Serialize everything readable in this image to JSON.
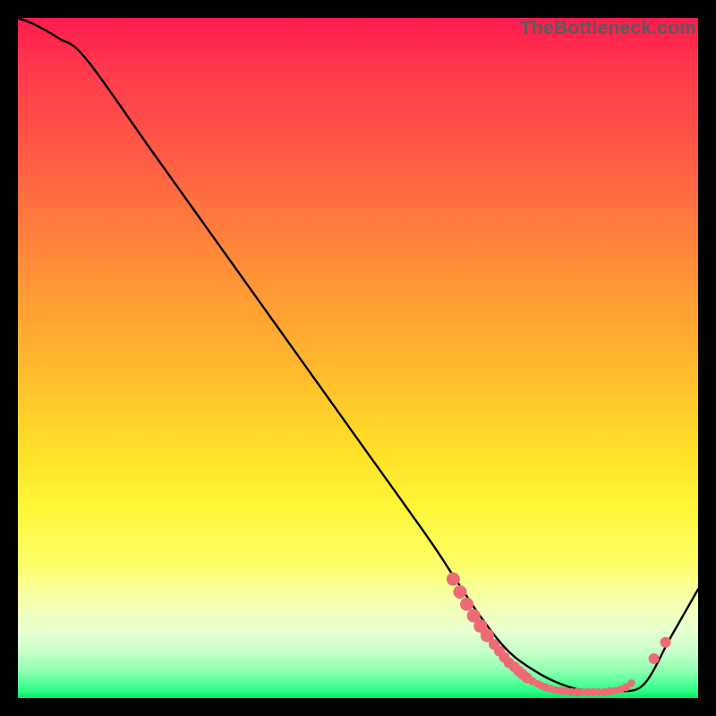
{
  "watermark": "TheBottleneck.com",
  "colors": {
    "curve": "#000000",
    "marker_fill": "#ed6b74",
    "marker_stroke": "#ed6b74",
    "background_black": "#000000"
  },
  "chart_data": {
    "type": "line",
    "title": "",
    "xlabel": "",
    "ylabel": "",
    "xlim": [
      0,
      100
    ],
    "ylim": [
      0,
      100
    ],
    "legend": false,
    "grid": false,
    "series": [
      {
        "name": "bottleneck-curve",
        "x": [
          0,
          2.5,
          6,
          10,
          20,
          30,
          40,
          50,
          60,
          64,
          68,
          72,
          76,
          80,
          84,
          88,
          92,
          96,
          100
        ],
        "y": [
          100,
          99,
          97,
          94,
          80,
          66,
          52,
          38,
          24,
          18,
          12,
          7,
          4,
          2,
          1,
          1,
          2,
          9,
          16
        ]
      }
    ],
    "markers": [
      {
        "x": 64.0,
        "y": 17.5
      },
      {
        "x": 65.0,
        "y": 15.6
      },
      {
        "x": 66.0,
        "y": 13.8
      },
      {
        "x": 67.0,
        "y": 12.1
      },
      {
        "x": 68.0,
        "y": 10.6
      },
      {
        "x": 69.0,
        "y": 9.2
      },
      {
        "x": 70.0,
        "y": 7.9
      },
      {
        "x": 70.8,
        "y": 6.9
      },
      {
        "x": 71.5,
        "y": 6.0
      },
      {
        "x": 72.2,
        "y": 5.2
      },
      {
        "x": 73.0,
        "y": 4.6
      },
      {
        "x": 73.6,
        "y": 4.0
      },
      {
        "x": 74.2,
        "y": 3.5
      },
      {
        "x": 74.8,
        "y": 3.0
      },
      {
        "x": 75.6,
        "y": 2.5
      },
      {
        "x": 76.4,
        "y": 2.1
      },
      {
        "x": 77.0,
        "y": 1.8
      },
      {
        "x": 77.6,
        "y": 1.6
      },
      {
        "x": 78.3,
        "y": 1.4
      },
      {
        "x": 79.0,
        "y": 1.2
      },
      {
        "x": 79.8,
        "y": 1.1
      },
      {
        "x": 80.6,
        "y": 1.0
      },
      {
        "x": 81.4,
        "y": 0.9
      },
      {
        "x": 82.2,
        "y": 0.9
      },
      {
        "x": 83.0,
        "y": 0.9
      },
      {
        "x": 83.8,
        "y": 0.9
      },
      {
        "x": 84.6,
        "y": 0.9
      },
      {
        "x": 85.4,
        "y": 0.9
      },
      {
        "x": 86.2,
        "y": 0.9
      },
      {
        "x": 87.0,
        "y": 1.0
      },
      {
        "x": 87.8,
        "y": 1.1
      },
      {
        "x": 88.6,
        "y": 1.3
      },
      {
        "x": 89.4,
        "y": 1.6
      },
      {
        "x": 90.2,
        "y": 2.2
      },
      {
        "x": 93.5,
        "y": 5.8
      },
      {
        "x": 95.2,
        "y": 8.2
      }
    ],
    "marker_radii": {
      "large": 7.5,
      "mid": 6.0,
      "small": 4.8,
      "tiny": 4.2
    },
    "annotations": []
  }
}
